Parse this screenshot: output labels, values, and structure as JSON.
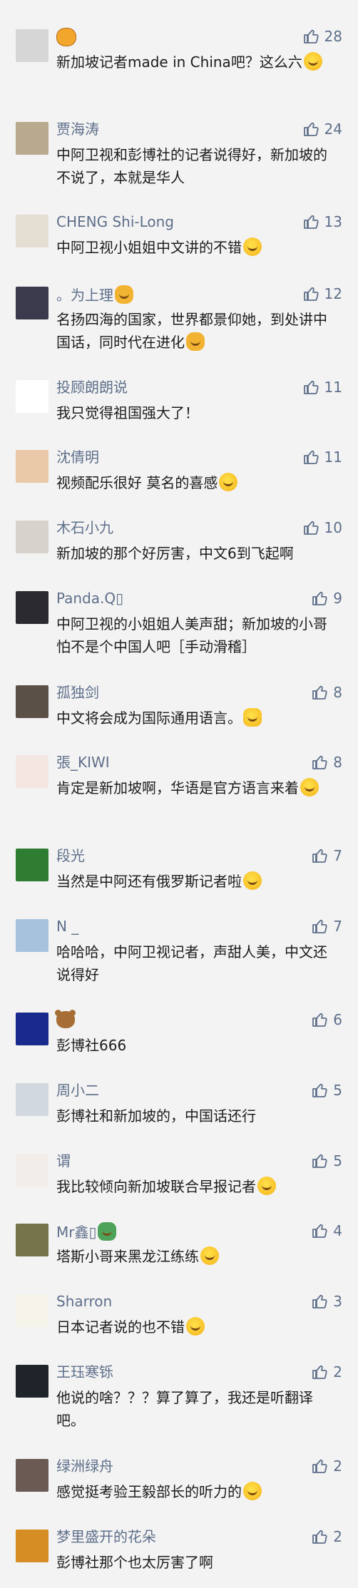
{
  "comments": [
    {
      "name": "",
      "name_icon": "tiger",
      "text": "新加坡记者made in China吧？这么六",
      "emoji": "laugh",
      "likes": "28",
      "avatar_color": "#d6d6d6"
    },
    {
      "name": "贾海涛",
      "text": "中阿卫视和彭博社的记者说得好，新加坡的不说了，本就是华人",
      "likes": "24",
      "avatar_color": "#b9a98e"
    },
    {
      "name": "CHENG Shi-Long",
      "text": "中阿卫视小姐姐中文讲的不错",
      "emoji": "grin",
      "likes": "13",
      "avatar_color": "#e4ddd2"
    },
    {
      "name": "。为上理",
      "name_icon": "muscle",
      "text": "名扬四海的国家，世界都景仰她，到处讲中国话，同时代在进化",
      "emoji": "muscle",
      "likes": "12",
      "avatar_color": "#3b3a4c"
    },
    {
      "name": "投顾朗朗说",
      "text": "我只觉得祖国强大了！",
      "likes": "11",
      "avatar_color": "#ffffff"
    },
    {
      "name": "沈倩明",
      "text": "视频配乐很好 莫名的喜感",
      "emoji": "laugh",
      "likes": "11",
      "avatar_color": "#e9c9a8"
    },
    {
      "name": "木石小九",
      "text": "新加坡的那个好厉害，中文6到飞起啊",
      "likes": "10",
      "avatar_color": "#d7d2cc"
    },
    {
      "name": "Panda.Q▯",
      "text": "中阿卫视的小姐姐人美声甜；新加坡的小哥怕不是个中国人吧［手动滑稽］",
      "likes": "9",
      "avatar_color": "#2a2a2f"
    },
    {
      "name": "孤独剑",
      "text": "中文将会成为国际通用语言。",
      "emoji": "thumbs",
      "likes": "8",
      "avatar_color": "#5b5048"
    },
    {
      "name": "張_KIWI",
      "text": "肯定是新加坡啊，华语是官方语言来着",
      "emoji": "face",
      "likes": "8",
      "avatar_color": "#f4e7e2"
    },
    {
      "name": "段光",
      "text": "当然是中阿还有俄罗斯记者啦",
      "emoji": "think",
      "likes": "7",
      "avatar_color": "#2f7d33"
    },
    {
      "name": "N _",
      "text": "哈哈哈，中阿卫视记者，声甜人美，中文还说得好",
      "likes": "7",
      "avatar_color": "#a6c2dd"
    },
    {
      "name": "",
      "name_icon": "bear",
      "text": "彭博社666",
      "likes": "6",
      "avatar_color": "#1a2a8c"
    },
    {
      "name": "周小二",
      "text": "彭博社和新加坡的，中国话还行",
      "likes": "5",
      "avatar_color": "#d2d8e0"
    },
    {
      "name": "谓",
      "text": "我比较倾向新加坡联合早报记者",
      "emoji": "smile",
      "likes": "5",
      "avatar_color": "#f2ede8"
    },
    {
      "name": "Mr鑫▯",
      "name_icon": "dragon",
      "text": "塔斯小哥来黑龙江练练",
      "emoji": "think",
      "likes": "4",
      "avatar_color": "#76744a"
    },
    {
      "name": "Sharron",
      "text": "日本记者说的也不错",
      "emoji": "think",
      "likes": "3",
      "avatar_color": "#f6f4ea"
    },
    {
      "name": "王珏寒铄",
      "text": "他说的啥？？？算了算了，我还是听翻译吧。",
      "likes": "2",
      "avatar_color": "#1f242a"
    },
    {
      "name": "绿洲绿舟",
      "text": "感觉挺考验王毅部长的听力的",
      "emoji": "laugh",
      "likes": "2",
      "avatar_color": "#6a5a53"
    },
    {
      "name": "梦里盛开的花朵",
      "text": "彭博社那个也太厉害了啊",
      "likes": "2",
      "avatar_color": "#d58d24"
    }
  ]
}
